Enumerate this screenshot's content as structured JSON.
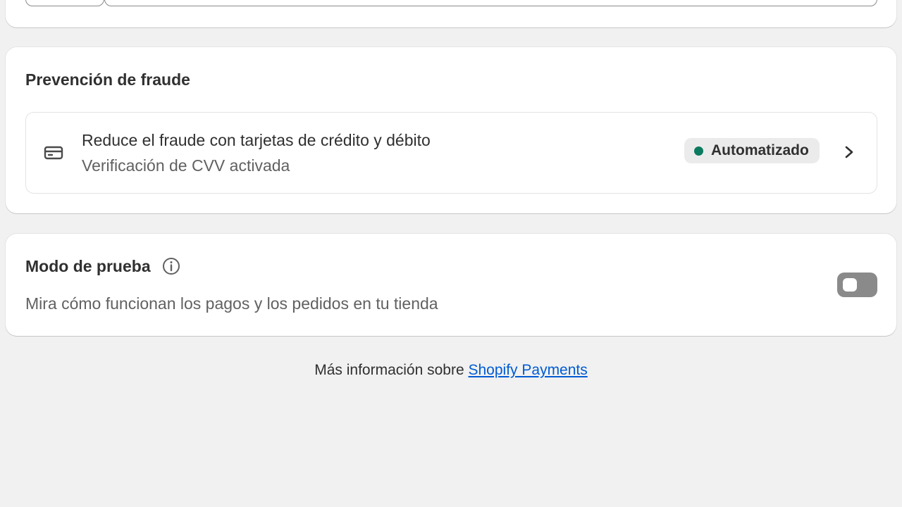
{
  "fraud": {
    "title": "Prevención de fraude",
    "row": {
      "title": "Reduce el fraude con tarjetas de crédito y débito",
      "subtitle": "Verificación de CVV activada",
      "badge": "Automatizado",
      "badge_color": "#0c7a5e",
      "icon": "credit-card-icon"
    }
  },
  "test_mode": {
    "title": "Modo de prueba",
    "description": "Mira cómo funcionan los pagos y los pedidos en tu tienda",
    "enabled": false
  },
  "footer": {
    "text": "Más información sobre",
    "link": "Shopify Payments",
    "link_color": "#005bd3"
  }
}
